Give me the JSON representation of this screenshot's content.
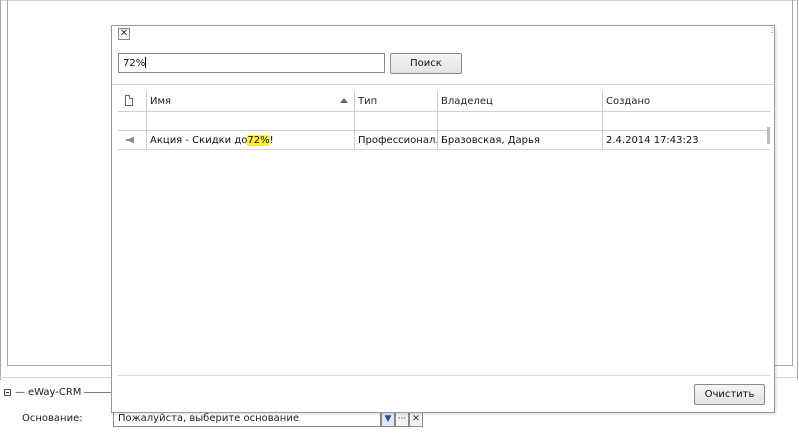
{
  "background": {
    "section_title": "eWay-CRM",
    "basis_label": "Основание:",
    "basis_value": "Пожалуйста, выберите основание",
    "combo_dropdown_glyph": "▼",
    "combo_more_glyph": "···",
    "combo_clear_glyph": "✕"
  },
  "dialog": {
    "close_glyph": "✕",
    "search_value": "72%",
    "search_button": "Поиск",
    "columns": [
      "Имя",
      "Тип",
      "Владелец",
      "Создано"
    ],
    "rows": [
      {
        "icon": "megaphone-icon",
        "name_prefix": "Акция - Скидки до ",
        "name_highlight": "72%",
        "name_suffix": "!",
        "type": "Профессионал...",
        "owner": "Бразовская, Дарья",
        "created": "2.4.2014 17:43:23"
      }
    ],
    "clear_button": "Очистить"
  },
  "colors": {
    "highlight": "#ffee3a",
    "border": "#8a8a8a"
  }
}
